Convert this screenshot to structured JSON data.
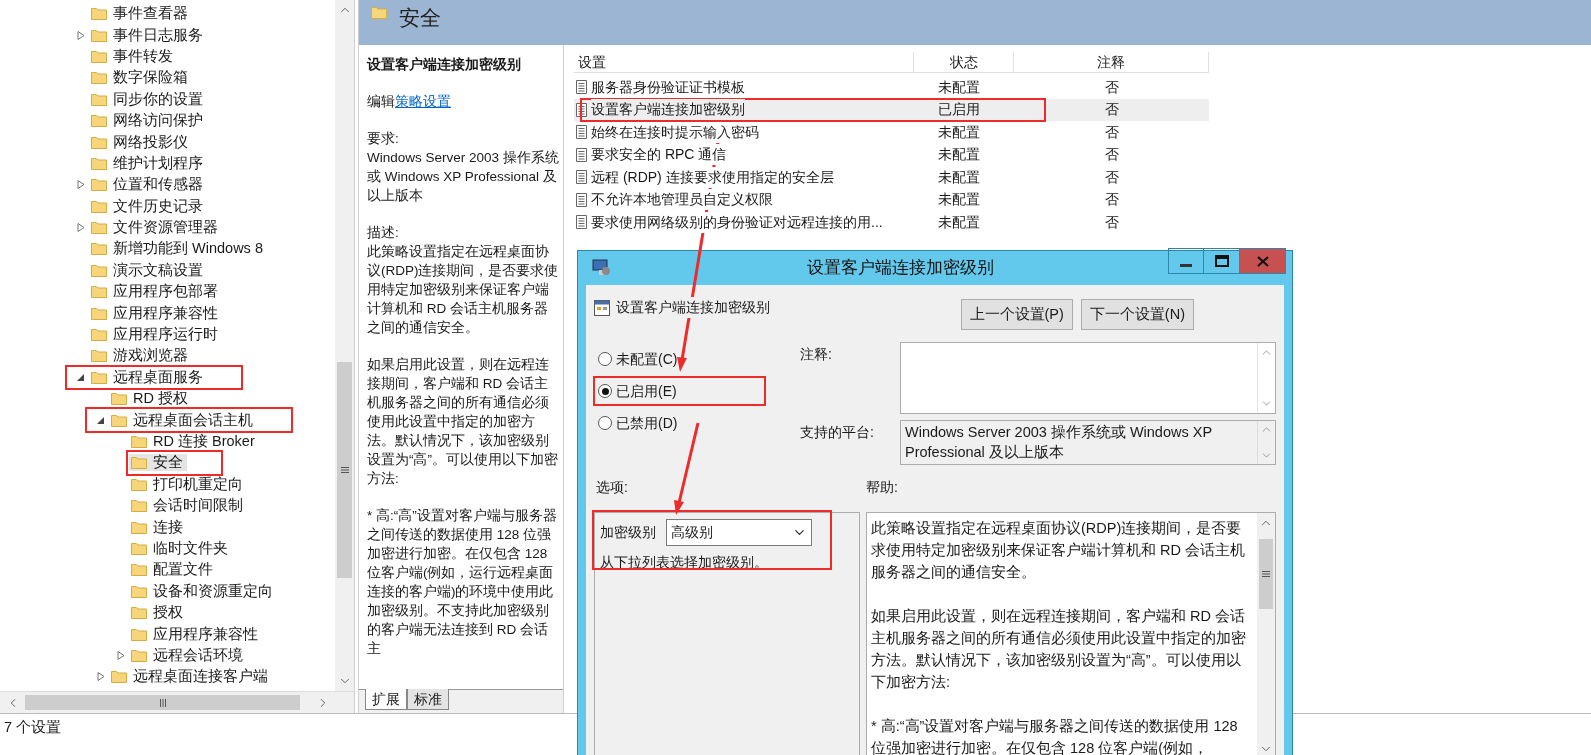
{
  "tree": {
    "items": [
      {
        "label": "事件查看器",
        "selected": false
      },
      {
        "label": "事件日志服务",
        "selected": false,
        "expanded": false
      },
      {
        "label": "事件转发",
        "selected": false
      },
      {
        "label": "数字保险箱",
        "selected": false
      },
      {
        "label": "同步你的设置",
        "selected": false
      },
      {
        "label": "网络访问保护",
        "selected": false
      },
      {
        "label": "网络投影仪",
        "selected": false
      },
      {
        "label": "维护计划程序",
        "selected": false
      },
      {
        "label": "位置和传感器",
        "selected": false,
        "expanded": false
      },
      {
        "label": "文件历史记录",
        "selected": false
      },
      {
        "label": "文件资源管理器",
        "selected": false,
        "expanded": false
      },
      {
        "label": "新增功能到 Windows 8",
        "selected": false
      },
      {
        "label": "演示文稿设置",
        "selected": false
      },
      {
        "label": "应用程序包部署",
        "selected": false
      },
      {
        "label": "应用程序兼容性",
        "selected": false
      },
      {
        "label": "应用程序运行时",
        "selected": false
      },
      {
        "label": "游戏浏览器",
        "selected": false
      },
      {
        "label": "远程桌面服务",
        "selected": false,
        "expanded": true,
        "annotated": true,
        "children": [
          {
            "label": "RD 授权",
            "selected": false
          },
          {
            "label": "远程桌面会话主机",
            "selected": false,
            "expanded": true,
            "annotated": true,
            "children": [
              {
                "label": "RD 连接 Broker",
                "selected": false
              },
              {
                "label": "安全",
                "selected": true,
                "annotated": true
              },
              {
                "label": "打印机重定向",
                "selected": false
              },
              {
                "label": "会话时间限制",
                "selected": false
              },
              {
                "label": "连接",
                "selected": false
              },
              {
                "label": "临时文件夹",
                "selected": false
              },
              {
                "label": "配置文件",
                "selected": false
              },
              {
                "label": "设备和资源重定向",
                "selected": false
              },
              {
                "label": "授权",
                "selected": false
              },
              {
                "label": "应用程序兼容性",
                "selected": false
              },
              {
                "label": "远程会话环境",
                "selected": false,
                "expanded": false
              }
            ]
          },
          {
            "label": "远程桌面连接客户端",
            "selected": false,
            "expanded": false
          }
        ]
      }
    ]
  },
  "status_bar": {
    "text": "7 个设置"
  },
  "header": {
    "title": "安全"
  },
  "description": {
    "title": "设置客户端连接加密级别",
    "edit_prefix": "编辑",
    "edit_link": "策略设置",
    "sections": [
      {
        "label": "要求:",
        "text": "Windows Server 2003 操作系统或 Windows XP Professional 及以上版本"
      },
      {
        "label": "描述:",
        "text": "此策略设置指定在远程桌面协议(RDP)连接期间，是否要求使用特定加密级别来保证客户端计算机和 RD 会话主机服务器之间的通信安全。"
      },
      {
        "text": "如果启用此设置，则在远程连接期间，客户端和 RD 会话主机服务器之间的所有通信必须使用此设置中指定的加密方法。默认情况下，该加密级别设置为“高”。可以使用以下加密方法:"
      },
      {
        "text": "* 高:“高”设置对客户端与服务器之间传送的数据使用 128 位强加密进行加密。在仅包含 128 位客户端(例如，运行远程桌面连接的客户端)的环境中使用此加密级别。不支持此加密级别的客户端无法连接到 RD 会话主"
      }
    ]
  },
  "tabs": [
    {
      "label": "扩展",
      "selected": true
    },
    {
      "label": "标准",
      "selected": false
    }
  ],
  "table": {
    "columns": [
      "设置",
      "状态",
      "注释"
    ],
    "rows": [
      {
        "cells": [
          "服务器身份验证证书模板",
          "未配置",
          "否"
        ],
        "selected": false,
        "annotated": false
      },
      {
        "cells": [
          "设置客户端连接加密级别",
          "已启用",
          "否"
        ],
        "selected": true,
        "annotated": true
      },
      {
        "cells": [
          "始终在连接时提示输入密码",
          "未配置",
          "否"
        ],
        "selected": false,
        "annotated": false
      },
      {
        "cells": [
          "要求安全的 RPC 通信",
          "未配置",
          "否"
        ],
        "selected": false,
        "annotated": false
      },
      {
        "cells": [
          "远程 (RDP) 连接要求使用指定的安全层",
          "未配置",
          "否"
        ],
        "selected": false,
        "annotated": false
      },
      {
        "cells": [
          "不允许本地管理员自定义权限",
          "未配置",
          "否"
        ],
        "selected": false,
        "annotated": false
      },
      {
        "cells": [
          "要求使用网络级别的身份验证对远程连接的用...",
          "未配置",
          "否"
        ],
        "selected": false,
        "annotated": false
      }
    ]
  },
  "dialog": {
    "title": "设置客户端连接加密级别",
    "setting_name": "设置客户端连接加密级别",
    "buttons": [
      "上一个设置(P)",
      "下一个设置(N)"
    ],
    "radios": [
      {
        "label": "未配置(C)",
        "selected": false,
        "annotated": false
      },
      {
        "label": "已启用(E)",
        "selected": true,
        "annotated": true
      },
      {
        "label": "已禁用(D)",
        "selected": false,
        "annotated": false
      }
    ],
    "comment_label": "注释:",
    "platform_label": "支持的平台:",
    "platform_text": "Windows Server 2003 操作系统或 Windows XP Professional 及以上版本",
    "options_label": "选项:",
    "help_label": "帮助:",
    "options_panel": {
      "annotated": true,
      "field_label": "加密级别",
      "select_value": "高级别",
      "hint": "从下拉列表选择加密级别。"
    },
    "help_paragraphs": [
      "此策略设置指定在远程桌面协议(RDP)连接期间，是否要求使用特定加密级别来保证客户端计算机和 RD 会话主机服务器之间的通信安全。",
      "如果启用此设置，则在远程连接期间，客户端和 RD 会话主机服务器之间的所有通信必须使用此设置中指定的加密方法。默认情况下，该加密级别设置为“高”。可以使用以下加密方法:",
      "* 高:“高”设置对客户端与服务器之间传送的数据使用 128 位强加密进行加密。在仅包含 128 位客户端(例如，"
    ]
  }
}
